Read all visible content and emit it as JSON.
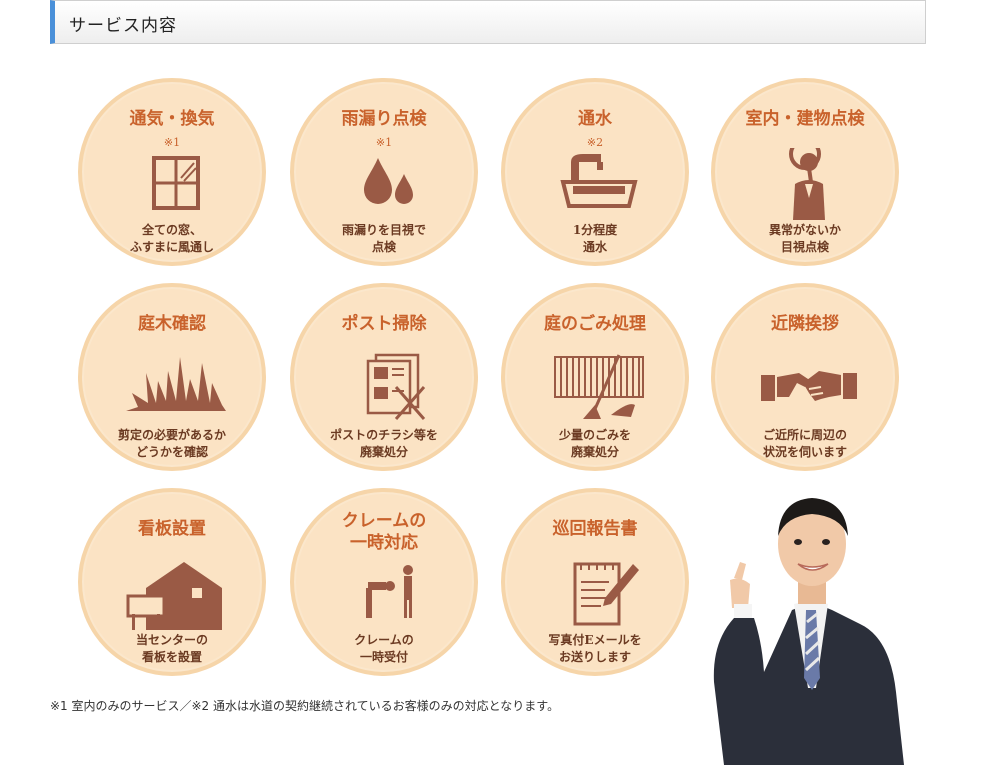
{
  "header": {
    "title": "サービス内容"
  },
  "services": [
    {
      "title": "通気・換気",
      "note": "※1",
      "desc": [
        "全ての窓、",
        "ふすまに風通し"
      ],
      "icon": "window-icon"
    },
    {
      "title": "雨漏り点検",
      "note": "※1",
      "desc": [
        "雨漏りを目視で",
        "点検"
      ],
      "icon": "water-drops-icon"
    },
    {
      "title": "通水",
      "note": "※2",
      "desc": [
        "1分程度",
        "通水"
      ],
      "icon": "faucet-sink-icon"
    },
    {
      "title": "室内・建物点検",
      "note": "",
      "desc": [
        "異常がないか",
        "目視点検"
      ],
      "icon": "magnifier-inspector-icon"
    },
    {
      "title": "庭木確認",
      "note": "",
      "desc": [
        "剪定の必要があるか",
        "どうかを確認"
      ],
      "icon": "grass-icon"
    },
    {
      "title": "ポスト掃除",
      "note": "",
      "desc": [
        "ポストのチラシ等を",
        "廃棄処分"
      ],
      "icon": "flyers-discard-icon"
    },
    {
      "title": "庭のごみ処理",
      "note": "",
      "desc": [
        "少量のごみを",
        "廃棄処分"
      ],
      "icon": "broom-fence-icon"
    },
    {
      "title": "近隣挨拶",
      "note": "",
      "desc": [
        "ご近所に周辺の",
        "状況を伺います"
      ],
      "icon": "handshake-icon"
    },
    {
      "title": "看板設置",
      "note": "",
      "desc": [
        "当センターの",
        "看板を設置"
      ],
      "icon": "house-sign-icon"
    },
    {
      "title": [
        "クレームの",
        "一時対応"
      ],
      "note": "",
      "desc": [
        "クレームの",
        "一時受付"
      ],
      "icon": "bowing-person-icon"
    },
    {
      "title": "巡回報告書",
      "note": "",
      "desc": [
        "写真付Eメールを",
        "お送りします"
      ],
      "icon": "report-pen-icon"
    }
  ],
  "footnote": "※1 室内のみのサービス／※2 通水は水道の契約継続されているお客様のみの対応となります。",
  "colors": {
    "accent": "#4a90d9",
    "title": "#c9622c",
    "desc": "#6b3a22",
    "circle": "#fbe3c4",
    "icon": "#9a5a45"
  }
}
